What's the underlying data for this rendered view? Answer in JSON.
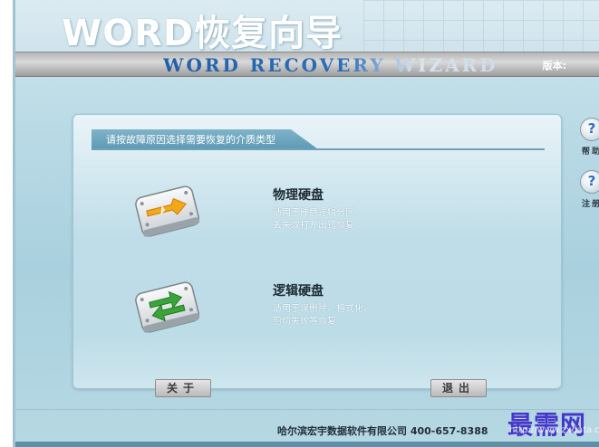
{
  "header": {
    "title": "WORD恢复向导",
    "subtitle": "WORD RECOVERY WIZARD",
    "version_label": "版本:"
  },
  "panel": {
    "instruction": "请按故障原因选择需要恢复的介质类型",
    "options": [
      {
        "title": "物理硬盘",
        "desc_line1": "适用于硬盘逻辑分区",
        "desc_line2": "丢失或打开出错恢复",
        "icon": "physical-disk-icon",
        "accent": "#f2a818"
      },
      {
        "title": "逻辑硬盘",
        "desc_line1": "适用于误删除、格式化、",
        "desc_line2": "剪切失败等恢复",
        "icon": "logical-disk-icon",
        "accent": "#3aa43a"
      }
    ],
    "about_button": "关于",
    "exit_button": "退出"
  },
  "side": {
    "help_label": "帮助",
    "help_icon": "question-icon",
    "register_label": "注册",
    "register_icon": "question-icon"
  },
  "footer": {
    "company": "哈尔滨宏宇数据软件有限公司 400-657-8388",
    "watermark": "最需网",
    "watermark_url": "http://www.zxdata.com"
  },
  "colors": {
    "background": "#b9dae5",
    "panel": "#bcdce7",
    "subtitle_blue": "#1f5fa8",
    "watermark": "#4636c9"
  }
}
